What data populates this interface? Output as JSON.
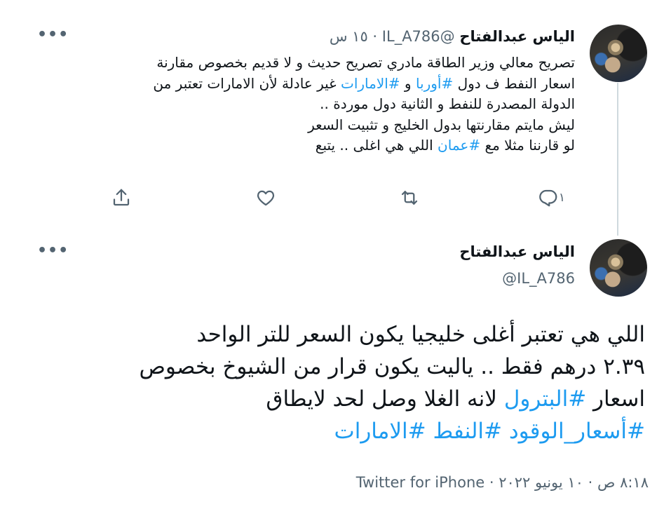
{
  "tweet1": {
    "author_name": "الياس عبدالفتاح",
    "handle": "@IL_A786",
    "separator": "·",
    "time": "١٥ س",
    "lines": [
      [
        {
          "t": "تصريح معالي وزير الطاقة مادري تصريح حديث و لا قديم بخصوص مقارنة"
        }
      ],
      [
        {
          "t": "اسعار النفط ف دول "
        },
        {
          "t": "#أوربا",
          "h": true
        },
        {
          "t": " و "
        },
        {
          "t": "#الامارات",
          "h": true
        },
        {
          "t": " غير عادلة لأن الامارات تعتبر من"
        }
      ],
      [
        {
          "t": "الدولة المصدرة للنفط و الثانية دول موردة .."
        }
      ],
      [
        {
          "t": "ليش مايتم مقارنتها بدول الخليج و تثبيت السعر"
        }
      ],
      [
        {
          "t": "لو قارننا مثلا مع "
        },
        {
          "t": "#عمان",
          "h": true
        },
        {
          "t": " اللي هي اغلى .. يتبع"
        }
      ]
    ],
    "reply_count": "١"
  },
  "tweet2": {
    "author_name": "الياس عبدالفتاح",
    "handle": "@IL_A786",
    "lines": [
      [
        {
          "t": "اللي هي تعتبر أغلى خليجيا يكون السعر للتر الواحد"
        }
      ],
      [
        {
          "t": "٢.٣٩ درهم فقط .. ياليت يكون قرار من الشيوخ بخصوص"
        }
      ],
      [
        {
          "t": "اسعار "
        },
        {
          "t": "#البترول",
          "h": true
        },
        {
          "t": " لانه الغلا وصل لحد لايطاق"
        }
      ],
      [
        {
          "t": "#أسعار_الوقود",
          "h": true
        },
        {
          "t": " "
        },
        {
          "t": "#النفط",
          "h": true
        },
        {
          "t": " "
        },
        {
          "t": "#الامارات",
          "h": true
        }
      ]
    ],
    "meta": "٨:١٨ ص · ١٠ يونيو ٢٠٢٢ · Twitter for iPhone"
  },
  "more_glyph": "•••",
  "colors": {
    "hashtag": "#1d9bf0",
    "muted": "#536471",
    "text": "#0f1419",
    "thread_line": "#cfd9de"
  },
  "icons": [
    "share-icon",
    "like-heart-icon",
    "retweet-icon",
    "reply-icon",
    "more-icon"
  ]
}
